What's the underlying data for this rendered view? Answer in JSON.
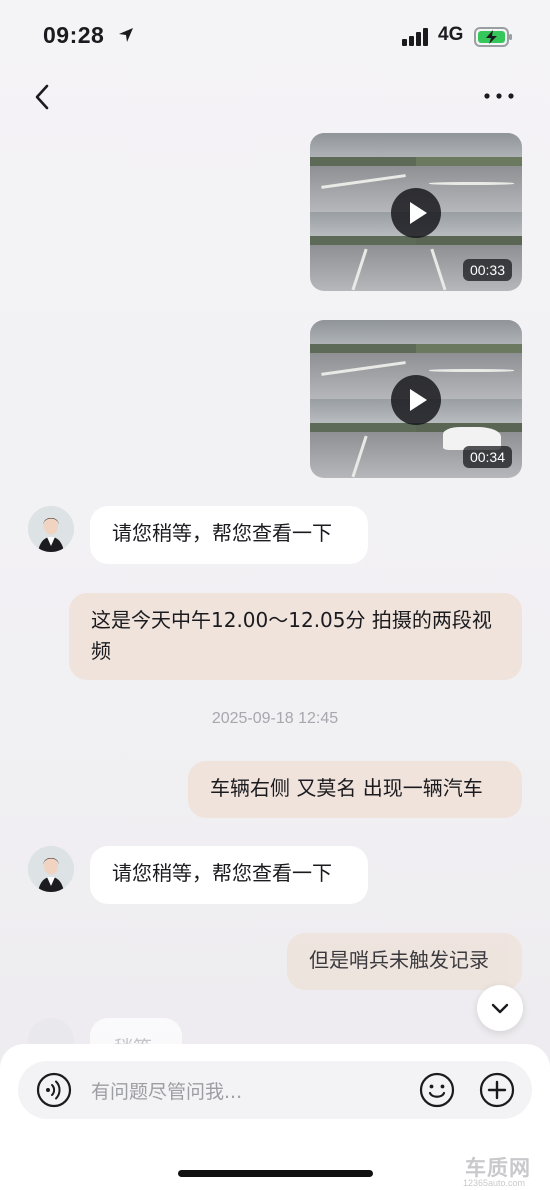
{
  "status_bar": {
    "time": "09:28",
    "network": "4G"
  },
  "messages": {
    "video_1": {
      "duration": "00:33"
    },
    "video_2": {
      "duration": "00:34"
    },
    "agent_1": "请您稍等，帮您查看一下",
    "user_1": "这是今天中午12.00～12.05分 拍摄的两段视频",
    "timestamp": "2025-09-18 12:45",
    "user_2": "车辆右侧 又莫名 出现一辆汽车",
    "agent_2": "请您稍等，帮您查看一下",
    "user_3": "但是哨兵未触发记录",
    "agent_3_partial": "稍等"
  },
  "input": {
    "placeholder": "有问题尽管问我..."
  },
  "icons": [
    "back-icon",
    "more-icon",
    "play-icon",
    "voice-icon",
    "emoji-icon",
    "plus-icon",
    "chevron-down-icon"
  ],
  "colors": {
    "user_bubble": "#efe3dc",
    "agent_bubble": "#ffffff",
    "background": "#f2f1f4"
  },
  "watermark": {
    "brand": "车质网",
    "site": "12365auto.com"
  }
}
